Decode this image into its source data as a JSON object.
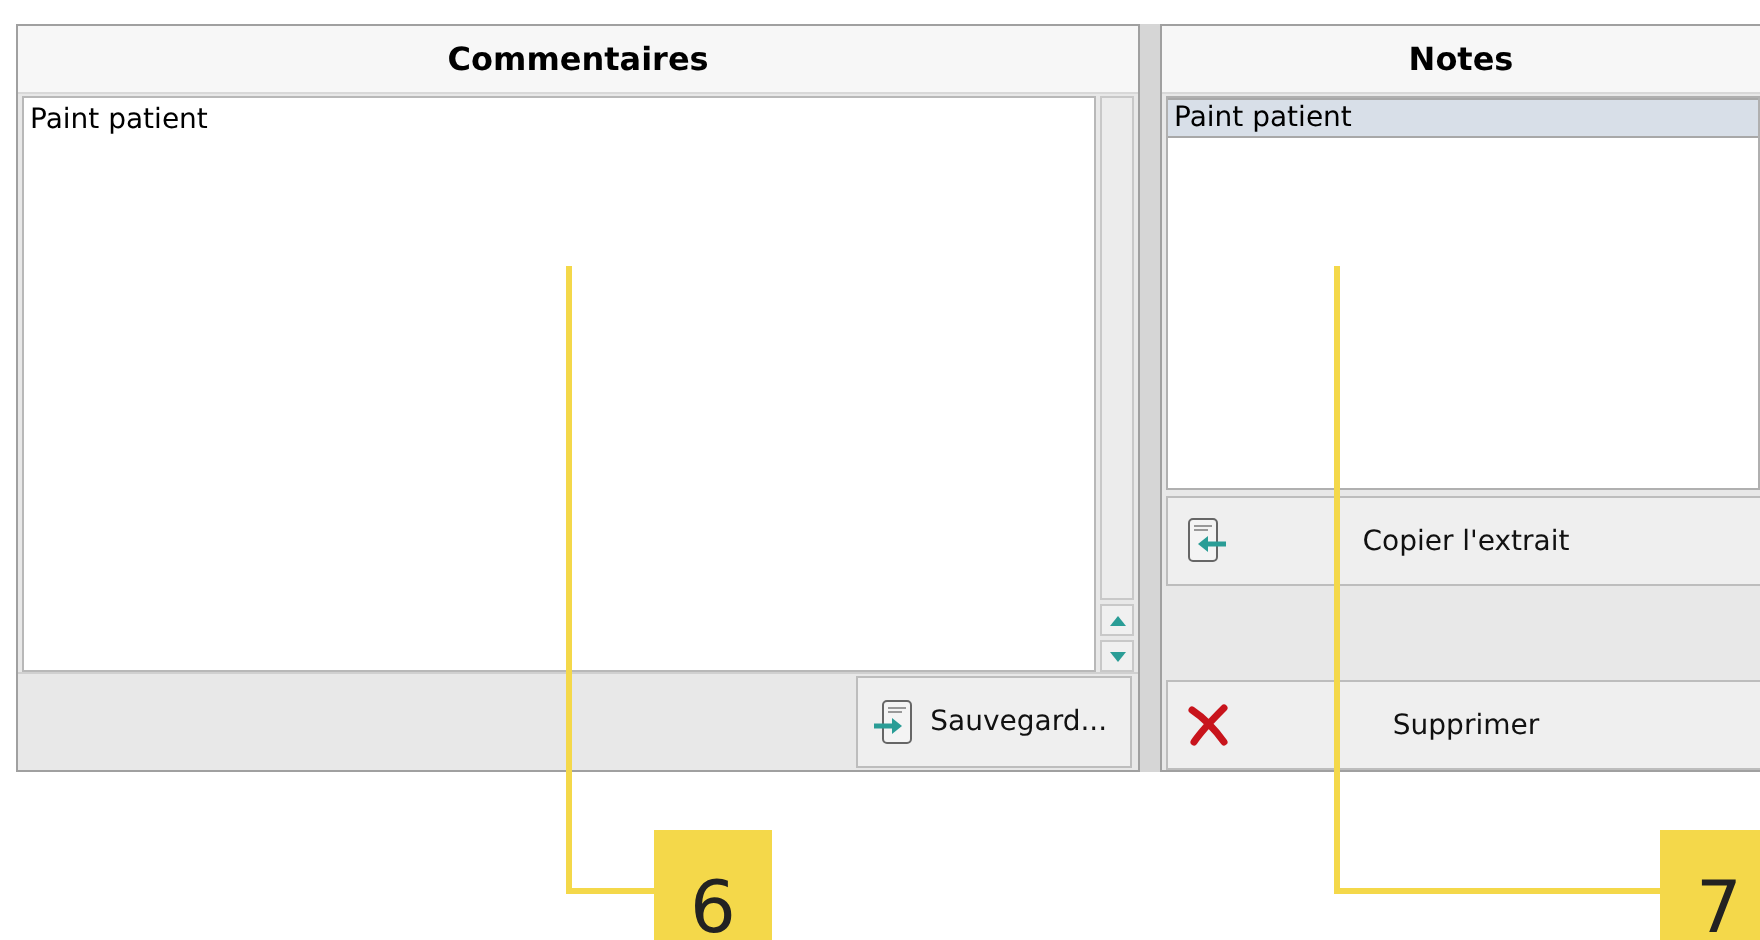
{
  "comments_panel": {
    "title": "Commentaires",
    "text": "Paint patient",
    "save_button": "Sauvegard..."
  },
  "notes_panel": {
    "title": "Notes",
    "items": [
      {
        "label": "Paint patient",
        "selected": true
      }
    ],
    "buttons": [
      {
        "kind": "copy",
        "label": "Copier l'extrait"
      },
      {
        "kind": "delete",
        "label": "Supprimer"
      }
    ]
  },
  "callouts": [
    {
      "label": "6"
    },
    {
      "label": "7"
    }
  ]
}
